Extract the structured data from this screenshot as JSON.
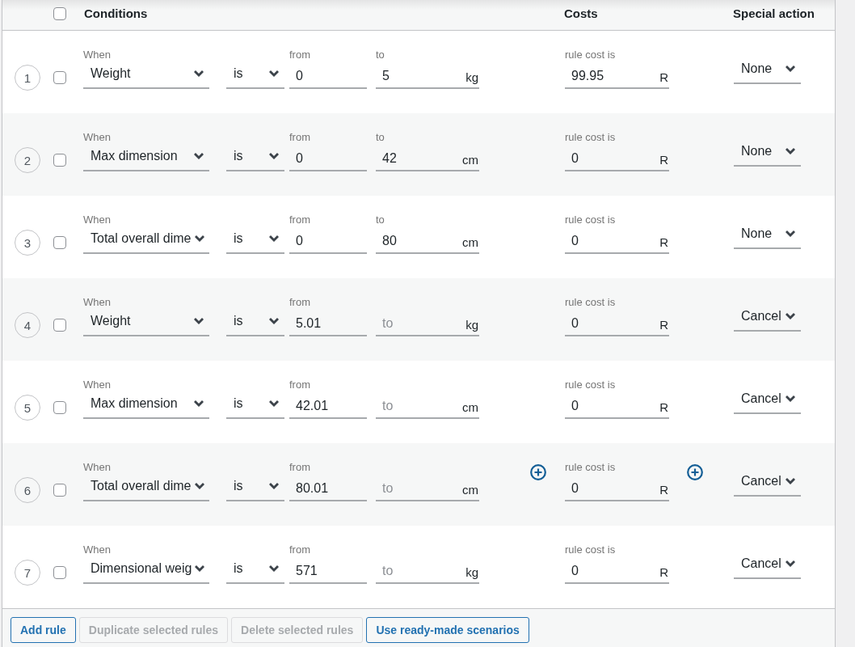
{
  "header": {
    "select_all": {
      "checked": false
    },
    "columns": [
      {
        "label": "Conditions"
      },
      {
        "label": "Costs"
      },
      {
        "label": "Special action"
      }
    ]
  },
  "rules": [
    {
      "number": "1",
      "checked": false,
      "hovered": false,
      "when_label": "When",
      "condition": "Weight",
      "operator": "is",
      "from": {
        "label": "from",
        "value": "0"
      },
      "to": {
        "label": "to",
        "value": "5"
      },
      "unit": "kg",
      "cost": {
        "label": "rule cost is",
        "value": "99.95",
        "currency": "R"
      },
      "action": "None"
    },
    {
      "number": "2",
      "checked": false,
      "hovered": false,
      "when_label": "When",
      "condition": "Max dimension",
      "operator": "is",
      "from": {
        "label": "from",
        "value": "0"
      },
      "to": {
        "label": "to",
        "value": "42"
      },
      "unit": "cm",
      "cost": {
        "label": "rule cost is",
        "value": "0",
        "currency": "R"
      },
      "action": "None"
    },
    {
      "number": "3",
      "checked": false,
      "hovered": false,
      "when_label": "When",
      "condition": "Total overall dime",
      "operator": "is",
      "from": {
        "label": "from",
        "value": "0"
      },
      "to": {
        "label": "to",
        "value": "80"
      },
      "unit": "cm",
      "cost": {
        "label": "rule cost is",
        "value": "0",
        "currency": "R"
      },
      "action": "None"
    },
    {
      "number": "4",
      "checked": false,
      "hovered": false,
      "when_label": "When",
      "condition": "Weight",
      "operator": "is",
      "from": {
        "label": "from",
        "value": "5.01"
      },
      "to": {
        "placeholder": "to"
      },
      "unit": "kg",
      "cost": {
        "label": "rule cost is",
        "value": "0",
        "currency": "R"
      },
      "action": "Cancel"
    },
    {
      "number": "5",
      "checked": false,
      "hovered": false,
      "when_label": "When",
      "condition": "Max dimension",
      "operator": "is",
      "from": {
        "label": "from",
        "value": "42.01"
      },
      "to": {
        "placeholder": "to"
      },
      "unit": "cm",
      "cost": {
        "label": "rule cost is",
        "value": "0",
        "currency": "R"
      },
      "action": "Cancel"
    },
    {
      "number": "6",
      "checked": false,
      "hovered": true,
      "when_label": "When",
      "condition": "Total overall dime",
      "operator": "is",
      "from": {
        "label": "from",
        "value": "80.01"
      },
      "to": {
        "placeholder": "to"
      },
      "unit": "cm",
      "cost": {
        "label": "rule cost is",
        "value": "0",
        "currency": "R"
      },
      "action": "Cancel"
    },
    {
      "number": "7",
      "checked": false,
      "hovered": false,
      "when_label": "When",
      "condition": "Dimensional weig",
      "operator": "is",
      "from": {
        "label": "from",
        "value": "571"
      },
      "to": {
        "placeholder": "to"
      },
      "unit": "kg",
      "cost": {
        "label": "rule cost is",
        "value": "0",
        "currency": "R"
      },
      "action": "Cancel"
    }
  ],
  "buttons": [
    {
      "label": "Add rule",
      "disabled": false
    },
    {
      "label": "Duplicate selected rules",
      "disabled": true
    },
    {
      "label": "Delete selected rules",
      "disabled": true
    },
    {
      "label": "Use ready-made scenarios",
      "disabled": false
    }
  ]
}
